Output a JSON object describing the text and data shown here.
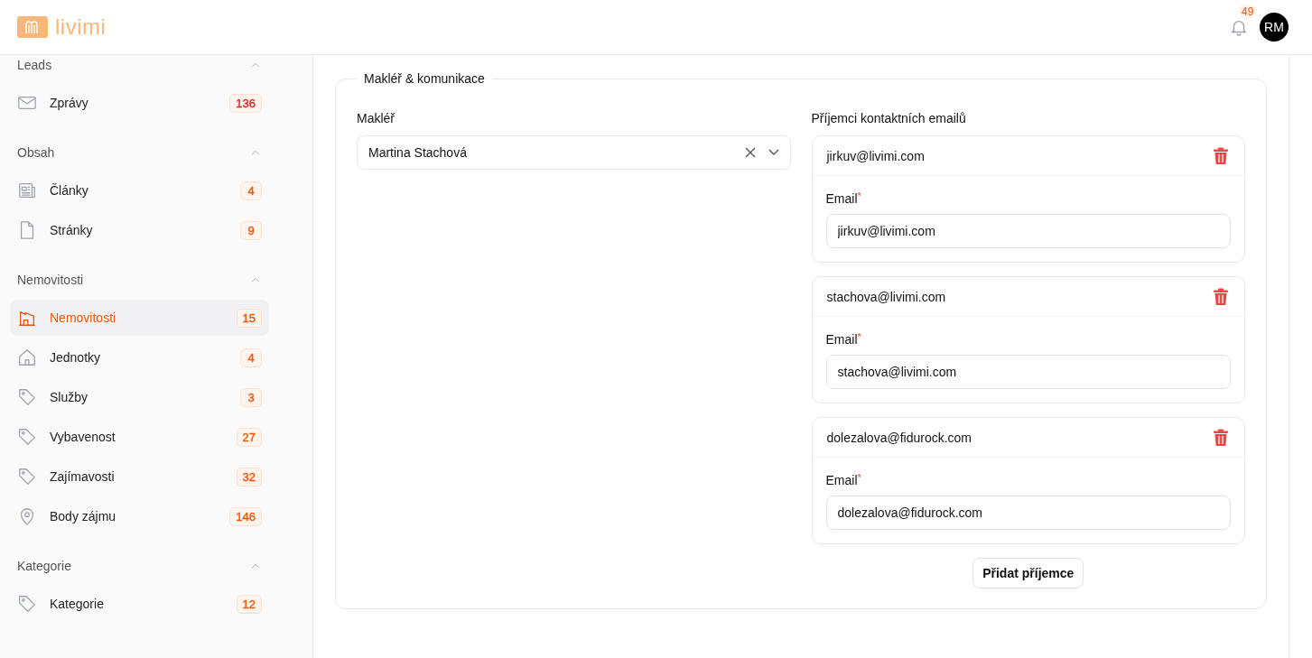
{
  "header": {
    "logo_text": "livimi",
    "notifications": {
      "count": "49"
    },
    "avatar": {
      "initials": "RM"
    }
  },
  "sidebar": {
    "sections": [
      {
        "title": "Leads",
        "expanded": true,
        "items": [
          {
            "label": "Zprávy",
            "badge": "136",
            "color": "#dc2626",
            "selected": false
          }
        ]
      },
      {
        "title": "Obsah",
        "expanded": true,
        "items": [
          {
            "label": "Články",
            "badge": "4",
            "color": "#ea580c",
            "selected": false
          },
          {
            "label": "Stránky",
            "badge": "9",
            "color": "#ea580c",
            "selected": false
          }
        ]
      },
      {
        "title": "Nemovitosti",
        "expanded": true,
        "items": [
          {
            "label": "Nemovitosti",
            "badge": "15",
            "color": "#ea580c",
            "selected": true
          },
          {
            "label": "Jednotky",
            "badge": "4",
            "color": "#ea580c",
            "selected": false
          },
          {
            "label": "Služby",
            "badge": "3",
            "color": "#ea580c",
            "selected": false
          },
          {
            "label": "Vybavenost",
            "badge": "27",
            "color": "#ea580c",
            "selected": false
          },
          {
            "label": "Zajímavosti",
            "badge": "32",
            "color": "#ea580c",
            "selected": false
          },
          {
            "label": "Body zájmu",
            "badge": "146",
            "color": "#ea580c",
            "selected": false
          }
        ]
      },
      {
        "title": "Kategorie",
        "expanded": true,
        "items": [
          {
            "label": "Kategorie",
            "badge": "12",
            "color": "#ea580c",
            "selected": false
          }
        ]
      }
    ]
  },
  "form": {
    "legend": "Makléř & komunikace",
    "agent": {
      "label": "Makléř",
      "value": "Martina Stachová"
    },
    "recipients": {
      "label": "Příjemci kontaktních emailů",
      "items": [
        {
          "title": "jirkuv@livimi.com",
          "field_label": "Email",
          "required_mark": "*",
          "value": "jirkuv@livimi.com"
        },
        {
          "title": "stachova@livimi.com",
          "field_label": "Email",
          "required_mark": "*",
          "value": "stachova@livimi.com"
        },
        {
          "title": "dolezalova@fidurock.com",
          "field_label": "Email",
          "required_mark": "*",
          "value": "dolezalova@fidurock.com"
        }
      ],
      "add_button": "Přidat příjemce"
    }
  }
}
